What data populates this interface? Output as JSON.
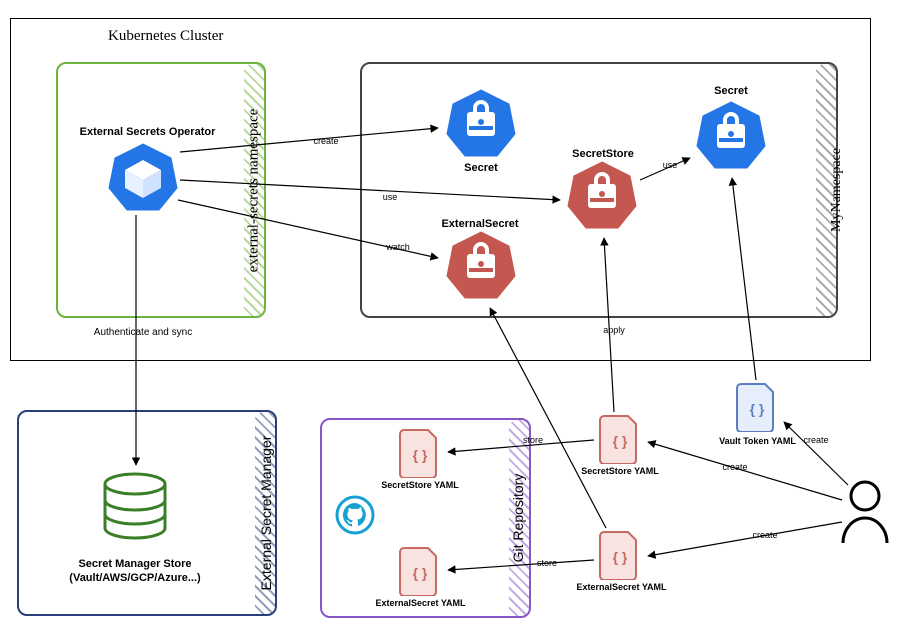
{
  "diagram": {
    "title": "Kubernetes Cluster",
    "namespaces": {
      "eso": "external-secrets namespace",
      "my": "MyNamespace"
    },
    "nodes": {
      "operator": "External Secrets Operator",
      "secret1": "Secret",
      "secret2": "Secret",
      "secretStore": "SecretStore",
      "externalSecret": "ExternalSecret",
      "esm_box": "External Secret Manager",
      "sms_line1": "Secret Manager Store",
      "sms_line2": "(Vault/AWS/GCP/Azure...)",
      "git_box": "Git Repository",
      "ssyaml_git": "SecretStore YAML",
      "esyaml_git": "ExternalSecret YAML",
      "ssyaml_user": "SecretStore YAML",
      "esyaml_user": "ExternalSecret YAML",
      "vtyaml": "Vault Token YAML",
      "user": "User"
    },
    "edges": {
      "auth_sync": "Authenticate and sync",
      "create": "create",
      "use": "use",
      "watch": "watch",
      "apply": "apply",
      "store": "store"
    }
  }
}
